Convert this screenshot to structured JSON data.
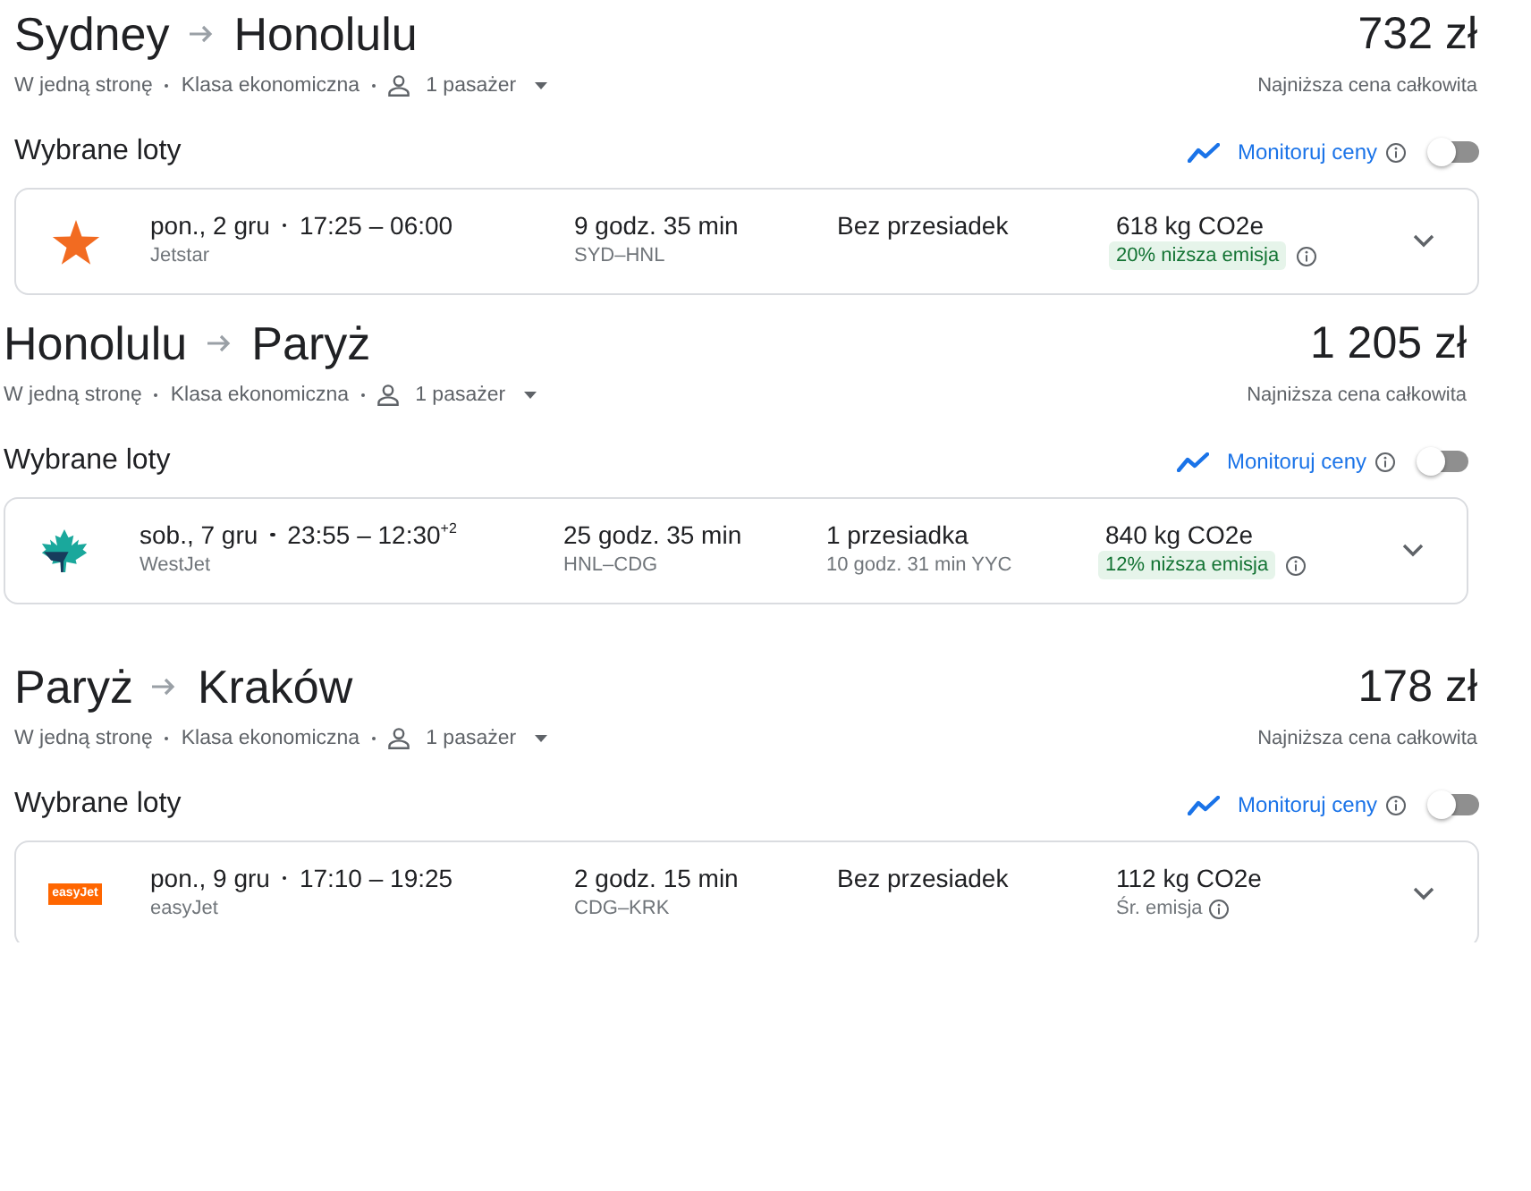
{
  "trips": [
    {
      "origin": "Sydney",
      "destination": "Honolulu",
      "price": "732 zł",
      "trip_type": "W jedną stronę",
      "cabin_class": "Klasa ekonomiczna",
      "passengers": "1 pasażer",
      "price_note": "Najniższa cena całkowita",
      "selected_heading": "Wybrane loty",
      "price_tracking": {
        "label": "Monitoruj ceny",
        "on": false
      },
      "flight": {
        "logo": {
          "kind": "star"
        },
        "date": "pon., 2 gru",
        "times": "17:25 – 06:00",
        "airline": "Jetstar",
        "duration": "9 godz. 35 min",
        "route": "SYD–HNL",
        "stops": "Bez przesiadek",
        "emissions": "618 kg CO2e",
        "emission_note": {
          "kind": "lower",
          "text": "20% niższa emisja"
        },
        "expanded": false
      }
    },
    {
      "origin": "Honolulu",
      "destination": "Paryż",
      "price": "1 205 zł",
      "trip_type": "W jedną stronę",
      "cabin_class": "Klasa ekonomiczna",
      "passengers": "1 pasażer",
      "price_note": "Najniższa cena całkowita",
      "selected_heading": "Wybrane loty",
      "price_tracking": {
        "label": "Monitoruj ceny",
        "on": false
      },
      "flight": {
        "logo": {
          "kind": "leaf"
        },
        "date": "sob., 7 gru",
        "times": "23:55 – 12:30$^{+2}$",
        "airline": "WestJet",
        "duration": "25 godz. 35 min",
        "route": "HNL–CDG",
        "stops": "1 przesiadka",
        "layover": "10 godz. 31 min YYC",
        "emissions": "840 kg CO2e",
        "emission_note": {
          "kind": "lower",
          "text": "12% niższa emisja"
        },
        "expanded": false
      }
    },
    {
      "origin": "Paryż",
      "destination": "Kraków",
      "price": "178 zł",
      "trip_type": "W jedną stronę",
      "cabin_class": "Klasa ekonomiczna",
      "passengers": "1 pasażer",
      "price_note": "Najniższa cena całkowita",
      "selected_heading": "Wybrane loty",
      "price_tracking": {
        "label": "Monitoruj ceny",
        "on": false
      },
      "flight": {
        "logo": {
          "kind": "wordmark",
          "text": "easyJet"
        },
        "date": "pon., 9 gru",
        "times": "17:10 – 19:25",
        "airline": "easyJet",
        "duration": "2 godz. 15 min",
        "route": "CDG–KRK",
        "stops": "Bez przesiadek",
        "emissions": "112 kg CO2e",
        "emission_note": {
          "kind": "average",
          "text": "Śr. emisja"
        },
        "expanded": false
      }
    }
  ]
}
